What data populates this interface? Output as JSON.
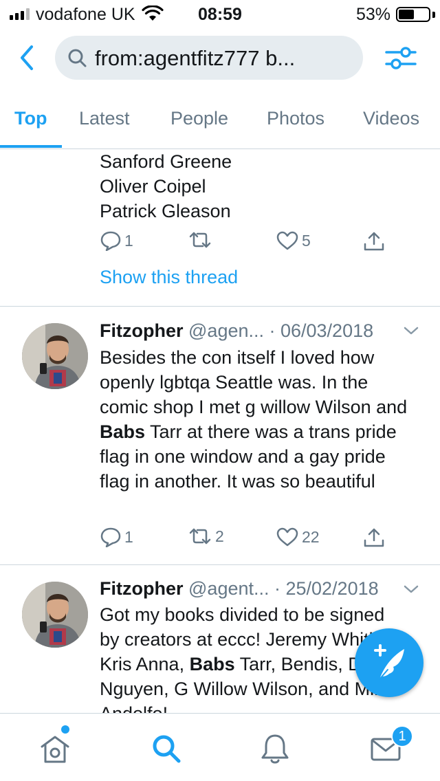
{
  "status_bar": {
    "carrier": "vodafone UK",
    "time": "08:59",
    "battery_percent": "53%",
    "battery_level": 0.53,
    "signal_bars": 3
  },
  "search": {
    "query": "from:agentfitz777 b..."
  },
  "tabs": [
    {
      "label": "Top",
      "active": true
    },
    {
      "label": "Latest",
      "active": false
    },
    {
      "label": "People",
      "active": false
    },
    {
      "label": "Photos",
      "active": false
    },
    {
      "label": "Videos",
      "active": false
    }
  ],
  "partial_tweet": {
    "lines": [
      "Sanford Greene",
      "Oliver Coipel",
      "Patrick Gleason"
    ],
    "replies": "1",
    "retweets": "",
    "likes": "5",
    "show_thread": "Show this thread"
  },
  "tweets": [
    {
      "name": "Fitzopher",
      "handle_date": "@agen... · 06/03/2018",
      "text_segments": [
        {
          "t": "Besides the con itself I loved how openly lgbtqa Seattle was. In the comic shop I met g willow Wilson and ",
          "bold": false
        },
        {
          "t": "Babs",
          "bold": true
        },
        {
          "t": " Tarr at there was a trans pride flag in one window and a gay pride flag in another. It was so beautiful",
          "bold": false
        }
      ],
      "replies": "1",
      "retweets": "2",
      "likes": "22"
    },
    {
      "name": "Fitzopher",
      "handle_date": "@agent... · 25/02/2018",
      "text_segments": [
        {
          "t": "Got my books divided to be signed by creators at eccc! Jeremy Whitley, Kris Anna, ",
          "bold": false
        },
        {
          "t": "Babs",
          "bold": true
        },
        {
          "t": " Tarr, Bendis, Dustin Nguyen, G Willow Wilson, and Mirka Andolfo!",
          "bold": false
        }
      ]
    }
  ],
  "bottom_nav": {
    "items": [
      "home-icon",
      "search-icon",
      "notifications-icon",
      "messages-icon"
    ],
    "active": "search-icon",
    "messages_badge": "1"
  },
  "colors": {
    "accent": "#1da1f2",
    "secondary_text": "#657786",
    "divider": "#ccd6dd",
    "search_bg": "#e6ecf0"
  }
}
